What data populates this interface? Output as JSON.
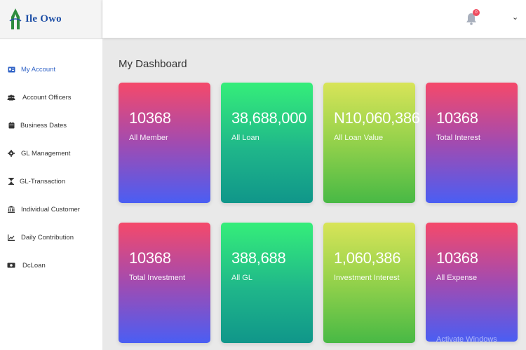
{
  "brand": {
    "name": "Ile Owo"
  },
  "topbar": {
    "notification_count": "0",
    "menu_chevron": "⌄"
  },
  "sidebar": {
    "items": [
      {
        "label": "My Account",
        "icon": "id-card-icon",
        "active": true
      },
      {
        "label": "Account Officers",
        "icon": "users-icon"
      },
      {
        "label": "Business Dates",
        "icon": "calendar-icon"
      },
      {
        "label": "GL Management",
        "icon": "gear-icon"
      },
      {
        "label": "GL-Transaction",
        "icon": "hourglass-icon"
      },
      {
        "label": "Individual Customer",
        "icon": "bank-icon"
      },
      {
        "label": "Daily Contribution",
        "icon": "chart-icon"
      },
      {
        "label": "DcLoan",
        "icon": "money-icon"
      }
    ]
  },
  "main": {
    "title": "My Dashboard",
    "cards": [
      {
        "value": "10368",
        "label": "All Member"
      },
      {
        "value": "38,688,000",
        "label": "All Loan"
      },
      {
        "value": "N10,060,386",
        "label": "All Loan Value"
      },
      {
        "value": "10368",
        "label": "Total Interest"
      },
      {
        "value": "10368",
        "label": "Total Investment"
      },
      {
        "value": "388,688",
        "label": "All GL"
      },
      {
        "value": "1,060,386",
        "label": "Investment Interest"
      },
      {
        "value": "10368",
        "label": "All Expense"
      }
    ]
  },
  "watermark": {
    "text": "Activate Windows"
  },
  "colors": {
    "accent": "#2f62c6",
    "pink_top": "#f5496a",
    "blue_bottom": "#4a5ef3",
    "green_top": "#35ee7a",
    "lime_top": "#d8e458"
  }
}
